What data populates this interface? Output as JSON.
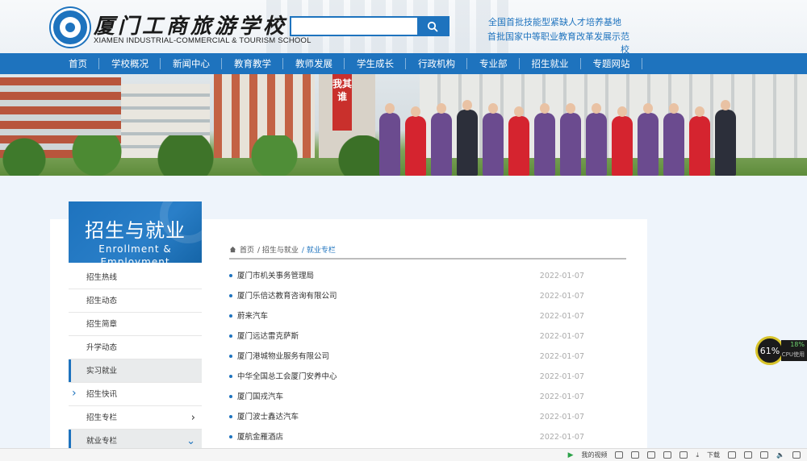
{
  "header": {
    "school_name_cn": "厦门工商旅游学校",
    "school_name_en": "XIAMEN INDUSTRIAL-COMMERCIAL & TOURISM SCHOOL",
    "search_placeholder": "",
    "slogan_line1": "全国首批技能型紧缺人才培养基地",
    "slogan_line2": "首批国家中等职业教育改革发展示范校"
  },
  "nav": {
    "items": [
      "首页",
      "学校概况",
      "新闻中心",
      "教育教学",
      "教师发展",
      "学生成长",
      "行政机构",
      "专业部",
      "招生就业",
      "专题网站"
    ]
  },
  "banner": {
    "sign_text": "我其谁"
  },
  "sidebar": {
    "title_cn": "招生与就业",
    "title_en_line1": "Enrollment &",
    "title_en_line2": "Employment",
    "items": [
      {
        "label": "招生热线"
      },
      {
        "label": "招生动态"
      },
      {
        "label": "招生简章"
      },
      {
        "label": "升学动态"
      },
      {
        "label": "实习就业"
      },
      {
        "label": "招生快讯"
      },
      {
        "label": "招生专栏"
      },
      {
        "label": "就业专栏"
      }
    ]
  },
  "breadcrumb": {
    "home": "首页",
    "level1": "/ 招生与就业",
    "current": "/ 就业专栏"
  },
  "news": [
    {
      "title": "厦门市机关事务管理局",
      "date": "2022-01-07"
    },
    {
      "title": "厦门乐倍达教育咨询有限公司",
      "date": "2022-01-07"
    },
    {
      "title": "蔚来汽车",
      "date": "2022-01-07"
    },
    {
      "title": "厦门远达雷克萨斯",
      "date": "2022-01-07"
    },
    {
      "title": "厦门港城物业服务有限公司",
      "date": "2022-01-07"
    },
    {
      "title": "中华全国总工会厦门安养中心",
      "date": "2022-01-07"
    },
    {
      "title": "厦门国戎汽车",
      "date": "2022-01-07"
    },
    {
      "title": "厦门波士鑫达汽车",
      "date": "2022-01-07"
    },
    {
      "title": "厦航金雁酒店",
      "date": "2022-01-07"
    }
  ],
  "cpu_widget": {
    "value": "61%",
    "cpu_percent": "18%",
    "cpu_label": "CPU使用"
  },
  "statusbar": {
    "video_label": "我的视频",
    "download_label": "下载"
  },
  "colors": {
    "brand_blue": "#1e73be",
    "date_gray": "#aaaaaa"
  }
}
